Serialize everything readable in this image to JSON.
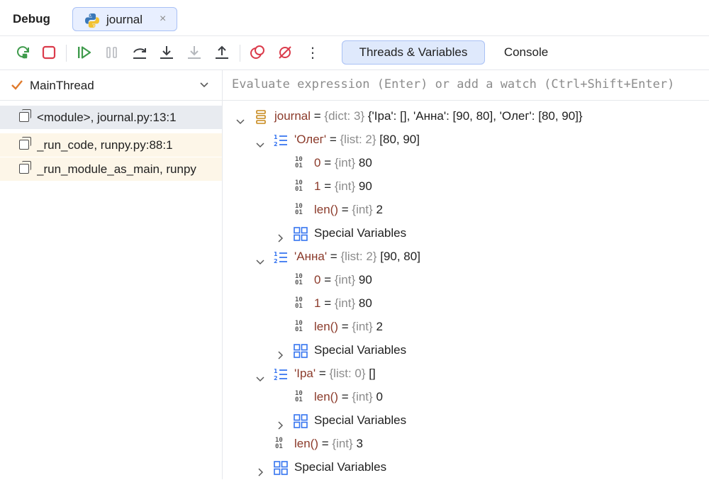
{
  "header": {
    "title": "Debug",
    "tab_label": "journal",
    "tab_close": "×"
  },
  "toolbar": {
    "threads_label": "Threads & Variables",
    "console_label": "Console",
    "more": "⋮"
  },
  "threads": {
    "current": "MainThread"
  },
  "frames": [
    {
      "label": "<module>, journal.py:13:1"
    },
    {
      "label": "_run_code, runpy.py:88:1"
    },
    {
      "label": "_run_module_as_main, runpy"
    }
  ],
  "evaluate": {
    "placeholder": "Evaluate expression (Enter) or add a watch (Ctrl+Shift+Enter)"
  },
  "variables": [
    {
      "name": "journal",
      "type": "{dict: 3}",
      "value": "{'Іра': [], 'Анна': [90, 80], 'Олег': [80, 90]}"
    },
    {
      "name": "'Олег'",
      "type": "{list: 2}",
      "value": "[80, 90]"
    },
    {
      "name": "0",
      "type": "{int}",
      "value": "80"
    },
    {
      "name": "1",
      "type": "{int}",
      "value": "90"
    },
    {
      "name": "len()",
      "type": "{int}",
      "value": "2"
    },
    {
      "name": "Special Variables"
    },
    {
      "name": "'Анна'",
      "type": "{list: 2}",
      "value": "[90, 80]"
    },
    {
      "name": "0",
      "type": "{int}",
      "value": "90"
    },
    {
      "name": "1",
      "type": "{int}",
      "value": "80"
    },
    {
      "name": "len()",
      "type": "{int}",
      "value": "2"
    },
    {
      "name": "Special Variables"
    },
    {
      "name": "'Іра'",
      "type": "{list: 0}",
      "value": "[]"
    },
    {
      "name": "len()",
      "type": "{int}",
      "value": "0"
    },
    {
      "name": "Special Variables"
    },
    {
      "name": "len()",
      "type": "{int}",
      "value": "3"
    },
    {
      "name": "Special Variables"
    }
  ],
  "icon_bits": {
    "top": "10",
    "bottom": "01"
  },
  "colors": {
    "accent": "#3574f0",
    "var_name": "#8b3a2a",
    "type_gray": "#8c8c8c",
    "stop_red": "#db3b4b",
    "resume_green": "#3f9b4c"
  }
}
